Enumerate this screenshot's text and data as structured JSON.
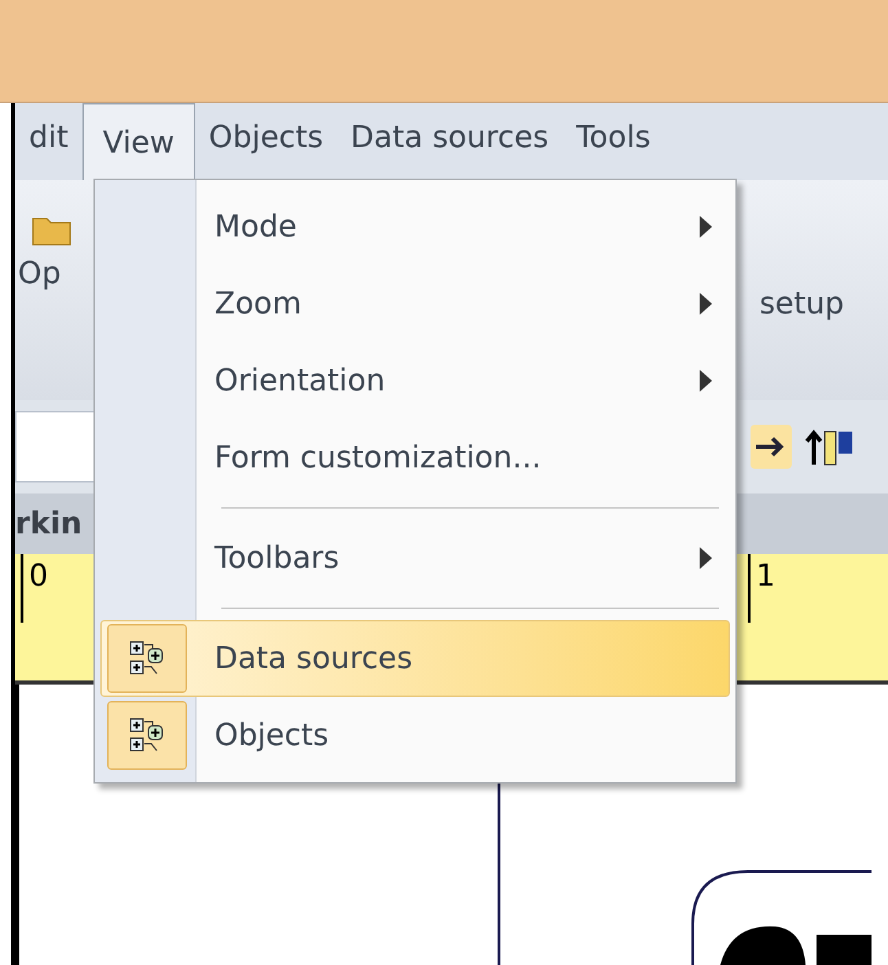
{
  "menu_bar": [
    {
      "label": "dit",
      "selected": false
    },
    {
      "label": "View",
      "selected": true
    },
    {
      "label": "Objects",
      "selected": false
    },
    {
      "label": "Data sources",
      "selected": false
    },
    {
      "label": "Tools",
      "selected": false
    }
  ],
  "toolbar": {
    "left_label": "Op",
    "right_label": "setup"
  },
  "panel": {
    "title": "rkin"
  },
  "ruler": {
    "marks": [
      "0",
      "1"
    ]
  },
  "view_menu": [
    {
      "kind": "submenu",
      "label": "Mode",
      "selected": false
    },
    {
      "kind": "submenu",
      "label": "Zoom",
      "selected": false
    },
    {
      "kind": "submenu",
      "label": "Orientation",
      "selected": false
    },
    {
      "kind": "command",
      "label": "Form customization...",
      "selected": false
    },
    {
      "kind": "separator"
    },
    {
      "kind": "submenu",
      "label": "Toolbars",
      "selected": false
    },
    {
      "kind": "separator"
    },
    {
      "kind": "toggle",
      "label": "Data sources",
      "selected": true,
      "checked": true
    },
    {
      "kind": "toggle",
      "label": "Objects",
      "selected": false,
      "checked": true
    }
  ]
}
